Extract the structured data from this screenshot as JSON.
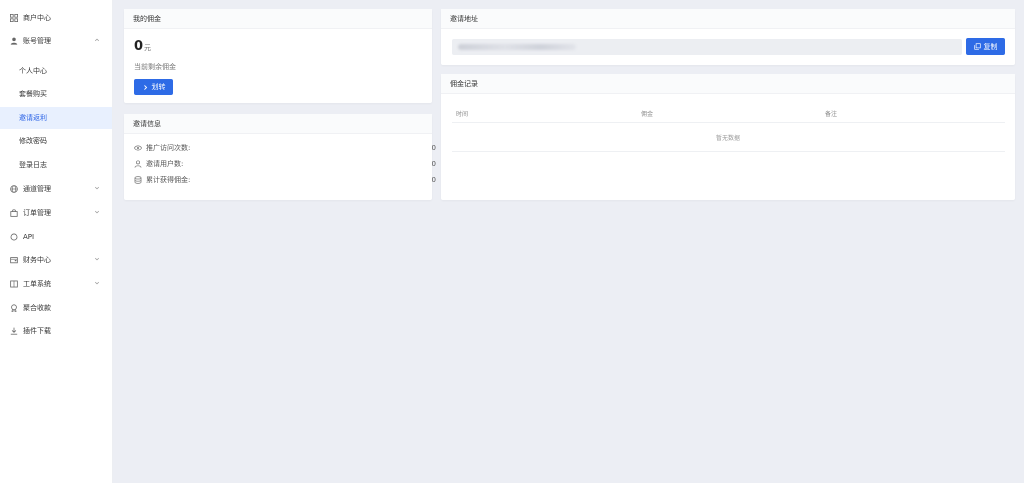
{
  "sidebar": {
    "items": [
      {
        "label": "商户中心",
        "icon": "grid-icon"
      },
      {
        "label": "账号管理",
        "icon": "user-icon",
        "expanded": true
      },
      {
        "label": "个人中心"
      },
      {
        "label": "套餐购买"
      },
      {
        "label": "邀请返利",
        "active": true
      },
      {
        "label": "修改密码"
      },
      {
        "label": "登录日志"
      },
      {
        "label": "通道管理",
        "icon": "globe-icon"
      },
      {
        "label": "订单管理",
        "icon": "bag-icon"
      },
      {
        "label": "API",
        "icon": "circle-icon"
      },
      {
        "label": "财务中心",
        "icon": "wallet-icon"
      },
      {
        "label": "工单系统",
        "icon": "book-icon"
      },
      {
        "label": "聚合收款",
        "icon": "award-icon"
      },
      {
        "label": "插件下载",
        "icon": "download-icon"
      }
    ]
  },
  "commission": {
    "title": "我的佣金",
    "amount": "0",
    "unit": "元",
    "sub_label": "当前剩余佣金",
    "transfer_label": "划转"
  },
  "invite_info": {
    "title": "邀请信息",
    "rows": [
      {
        "label": "推广访问次数:",
        "value": "0",
        "icon": "eye-icon"
      },
      {
        "label": "邀请用户数:",
        "value": "0",
        "icon": "user-icon"
      },
      {
        "label": "累计获得佣金:",
        "value": "0",
        "icon": "database-icon"
      }
    ]
  },
  "invite_url": {
    "title": "邀请地址",
    "copy_label": "复制"
  },
  "records": {
    "title": "佣金记录",
    "columns": [
      "时间",
      "佣金",
      "备注"
    ],
    "empty_text": "暂无数据"
  },
  "colors": {
    "accent": "#2e6be6",
    "active_bg": "#e8f0fe",
    "page_bg": "#eceef4"
  }
}
